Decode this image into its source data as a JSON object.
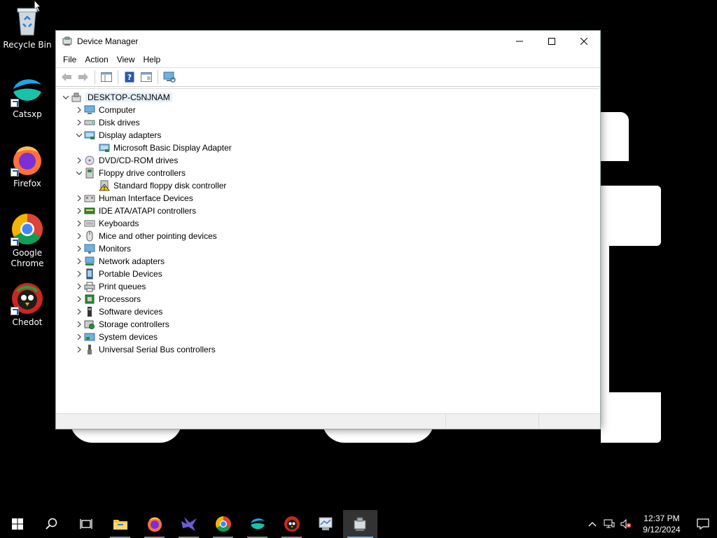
{
  "desktop": {
    "icons": [
      {
        "label": "Recycle Bin"
      },
      {
        "label": "Catsxp"
      },
      {
        "label": "Firefox"
      },
      {
        "label": "Google Chrome"
      },
      {
        "label": "Chedot"
      }
    ]
  },
  "window": {
    "title": "Device Manager",
    "menu": [
      "File",
      "Action",
      "View",
      "Help"
    ],
    "tree": {
      "root": "DESKTOP-C5NJNAM",
      "items": [
        {
          "label": "Computer",
          "icon": "computer-icon",
          "expanded": false
        },
        {
          "label": "Disk drives",
          "icon": "disk-drive-icon",
          "expanded": false
        },
        {
          "label": "Display adapters",
          "icon": "display-adapter-icon",
          "expanded": true
        },
        {
          "label": "Microsoft Basic Display Adapter",
          "icon": "display-adapter-icon",
          "child": true
        },
        {
          "label": "DVD/CD-ROM drives",
          "icon": "dvd-drive-icon",
          "expanded": false
        },
        {
          "label": "Floppy drive controllers",
          "icon": "floppy-controller-icon",
          "expanded": true
        },
        {
          "label": "Standard floppy disk controller",
          "icon": "warning-device-icon",
          "child": true
        },
        {
          "label": "Human Interface Devices",
          "icon": "hid-icon",
          "expanded": false
        },
        {
          "label": "IDE ATA/ATAPI controllers",
          "icon": "ide-controller-icon",
          "expanded": false
        },
        {
          "label": "Keyboards",
          "icon": "keyboard-icon",
          "expanded": false
        },
        {
          "label": "Mice and other pointing devices",
          "icon": "mouse-icon",
          "expanded": false
        },
        {
          "label": "Monitors",
          "icon": "monitor-icon",
          "expanded": false
        },
        {
          "label": "Network adapters",
          "icon": "network-adapter-icon",
          "expanded": false
        },
        {
          "label": "Portable Devices",
          "icon": "portable-device-icon",
          "expanded": false
        },
        {
          "label": "Print queues",
          "icon": "printer-icon",
          "expanded": false
        },
        {
          "label": "Processors",
          "icon": "processor-icon",
          "expanded": false
        },
        {
          "label": "Software devices",
          "icon": "software-device-icon",
          "expanded": false
        },
        {
          "label": "Storage controllers",
          "icon": "storage-controller-icon",
          "expanded": false
        },
        {
          "label": "System devices",
          "icon": "system-device-icon",
          "expanded": false
        },
        {
          "label": "Universal Serial Bus controllers",
          "icon": "usb-icon",
          "expanded": false
        }
      ]
    }
  },
  "taskbar": {
    "clock_time": "12:37 PM",
    "clock_date": "9/12/2024"
  },
  "colors": {
    "accent": "#76b9ed",
    "selection": "#e5f1fb"
  }
}
